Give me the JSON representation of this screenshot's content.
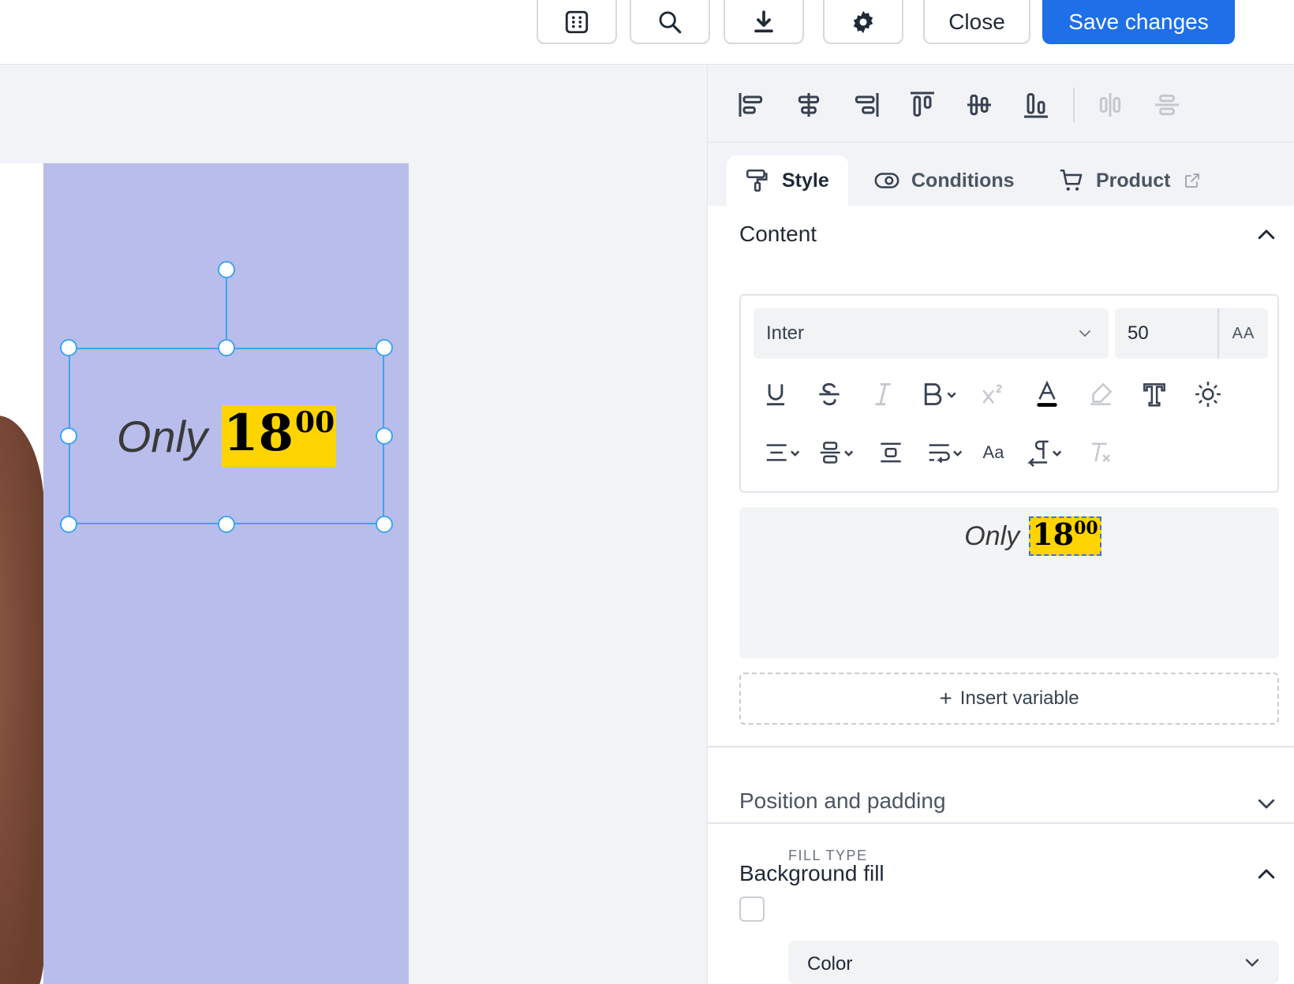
{
  "toolbar": {
    "icons": [
      "grid-icon",
      "search-icon",
      "download-icon",
      "gear-icon"
    ],
    "close_label": "Close",
    "save_label": "Save changes",
    "save_color": "#1e6fe8"
  },
  "canvas": {
    "banner_color": "#b9bdeb",
    "text_only": "Only",
    "price_main": "18",
    "price_sup": "00",
    "highlight_color": "#ffd400"
  },
  "panel": {
    "align_icons": [
      "align-left-icon",
      "align-center-horizontal-icon",
      "align-right-icon",
      "align-top-icon",
      "align-center-vertical-icon",
      "align-bottom-icon",
      "distribute-horizontal-icon",
      "distribute-vertical-icon"
    ],
    "tabs": [
      {
        "label": "Style",
        "icon": "paint-roller-icon"
      },
      {
        "label": "Conditions",
        "icon": "toggle-icon"
      },
      {
        "label": "Product",
        "icon": "cart-icon"
      }
    ],
    "content": {
      "title": "Content",
      "font": "Inter",
      "size": "50",
      "case_toggle": "AA",
      "text_tools": [
        "underline-icon",
        "strikethrough-icon",
        "italic-icon",
        "bold-icon",
        "superscript-icon",
        "text-color-icon",
        "highlight-icon",
        "text-style-icon",
        "effects-icon",
        "align-text-icon",
        "vertical-align-icon",
        "spacing-icon",
        "wrap-icon",
        "case-icon",
        "direction-icon",
        "clear-format-icon"
      ],
      "case_label": "Aa",
      "preview_only": "Only",
      "preview_main": "18",
      "preview_sup": "00",
      "insert_variable": "Insert variable"
    },
    "position_title": "Position and padding",
    "background_title": "Background fill",
    "fill_type_label": "FILL TYPE",
    "fill_type_value": "Color"
  }
}
